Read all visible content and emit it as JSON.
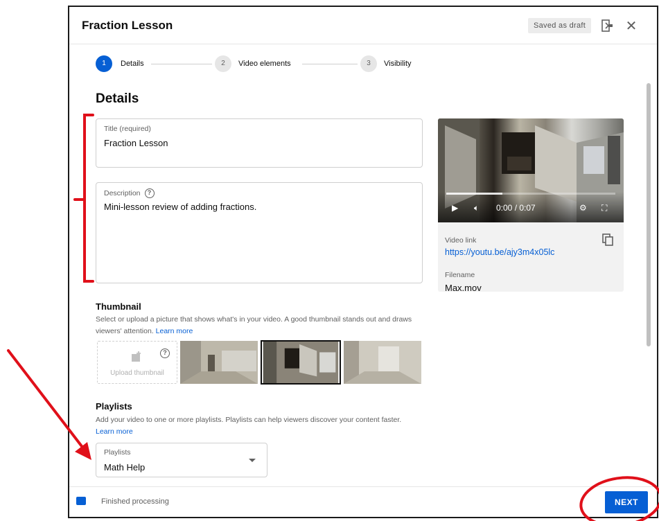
{
  "dialog": {
    "title": "Fraction Lesson",
    "saved_badge": "Saved as draft"
  },
  "steps": [
    {
      "number": "1",
      "label": "Details"
    },
    {
      "number": "2",
      "label": "Video elements"
    },
    {
      "number": "3",
      "label": "Visibility"
    }
  ],
  "details": {
    "heading": "Details",
    "title_field": {
      "label": "Title (required)",
      "value": "Fraction Lesson"
    },
    "description_field": {
      "label": "Description",
      "value": "Mini-lesson review of adding fractions."
    }
  },
  "video": {
    "time": "0:00 / 0:07",
    "progress": 0.33,
    "link_label": "Video link",
    "link": "https://youtu.be/ajy3m4x05lc",
    "filename_label": "Filename",
    "filename": "Max.mov"
  },
  "thumbnail": {
    "title": "Thumbnail",
    "description": "Select or upload a picture that shows what's in your video. A good thumbnail stands out and draws viewers' attention.",
    "learn_more": "Learn more",
    "upload_label": "Upload thumbnail",
    "selected_index": 1
  },
  "playlists": {
    "title": "Playlists",
    "description": "Add your video to one or more playlists. Playlists can help viewers discover your content faster.",
    "learn_more": "Learn more",
    "select_label": "Playlists",
    "select_value": "Math Help"
  },
  "footer": {
    "status": "Finished processing",
    "next_label": "NEXT"
  },
  "colors": {
    "accent": "#065fd4",
    "annotation": "#e0101a"
  }
}
